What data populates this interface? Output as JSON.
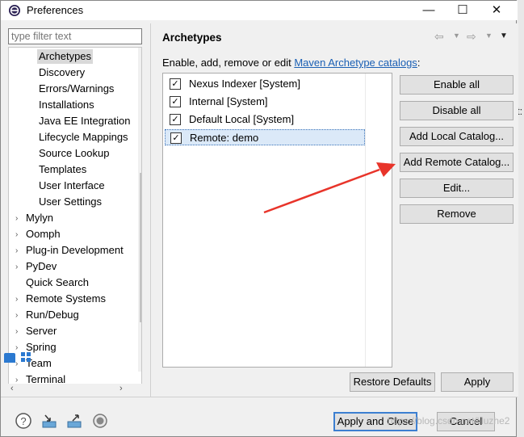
{
  "window": {
    "title": "Preferences",
    "minimize": "—",
    "maximize": "☐",
    "close": "✕"
  },
  "sidebar": {
    "filter_placeholder": "type filter text",
    "children": [
      "Archetypes",
      "Discovery",
      "Errors/Warnings",
      "Installations",
      "Java EE Integration",
      "Lifecycle Mappings",
      "Source Lookup",
      "Templates",
      "User Interface",
      "User Settings"
    ],
    "groups": [
      "Mylyn",
      "Oomph",
      "Plug-in Development",
      "PyDev",
      "Quick Search",
      "Remote Systems",
      "Run/Debug",
      "Server",
      "Spring",
      "Team",
      "Terminal"
    ]
  },
  "page": {
    "title": "Archetypes",
    "description": "Enable, add, remove or edit ",
    "link": "Maven Archetype catalogs",
    "description_end": ":",
    "catalogs": [
      {
        "label": "Nexus Indexer [System]",
        "checked": true
      },
      {
        "label": "Internal [System]",
        "checked": true
      },
      {
        "label": "Default Local [System]",
        "checked": true
      },
      {
        "label": "Remote: demo",
        "checked": true
      }
    ],
    "buttons": {
      "enable_all": "Enable all",
      "disable_all": "Disable all",
      "add_local": "Add Local Catalog...",
      "add_remote": "Add Remote Catalog...",
      "edit": "Edit...",
      "remove": "Remove"
    },
    "restore_defaults": "Restore Defaults",
    "apply": "Apply"
  },
  "footer": {
    "apply_and_close": "Apply and Close",
    "cancel": "Cancel"
  },
  "watermark": "https://blog.csdn.net/liluzhe2",
  "colors": {
    "arrow": "#e8342a",
    "selection": "#dbe9f8",
    "link": "#1a5fb4"
  }
}
